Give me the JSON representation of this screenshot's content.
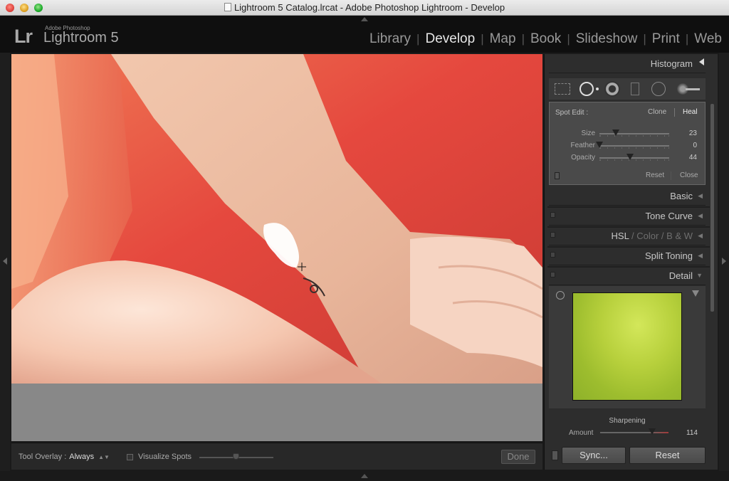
{
  "window": {
    "title": "Lightroom 5 Catalog.lrcat - Adobe Photoshop Lightroom - Develop"
  },
  "header": {
    "logo": "Lr",
    "brand_small": "Adobe Photoshop",
    "brand_name": "Lightroom 5",
    "modules": [
      "Library",
      "Develop",
      "Map",
      "Book",
      "Slideshow",
      "Print",
      "Web"
    ],
    "active_module": "Develop"
  },
  "toolbar": {
    "overlay_label": "Tool Overlay :",
    "overlay_value": "Always",
    "visualize_label": "Visualize Spots",
    "visualize_checked": false,
    "done_label": "Done"
  },
  "panel": {
    "histogram": "Histogram",
    "tools": [
      "grid-crop-icon",
      "spot-removal-icon",
      "red-eye-icon",
      "graduated-filter-icon",
      "radial-filter-icon",
      "adjustment-brush-icon"
    ],
    "spot_edit": {
      "title": "Spot Edit :",
      "clone": "Clone",
      "heal": "Heal",
      "selected_mode": "Heal",
      "sliders": [
        {
          "label": "Size",
          "value": "23",
          "fraction": 0.23
        },
        {
          "label": "Feather",
          "value": "0",
          "fraction": 0.0
        },
        {
          "label": "Opacity",
          "value": "44",
          "fraction": 0.44
        }
      ],
      "reset": "Reset",
      "close": "Close"
    },
    "sections": {
      "basic": "Basic",
      "tone_curve": "Tone Curve",
      "hsl": "HSL",
      "hsl_sep": "/",
      "color": "Color",
      "bw": "B & W",
      "split_toning": "Split Toning",
      "detail": "Detail"
    },
    "sharpening": {
      "title": "Sharpening",
      "amount_label": "Amount",
      "amount_value": "114",
      "fraction": 0.76
    },
    "sync_button": "Sync...",
    "reset_button": "Reset"
  },
  "colors": {
    "accent_text": "#e6e6e6",
    "panel_bg": "#2d2d2d",
    "preview_green": "#b7d03c",
    "photo_red": "#e24a3e"
  }
}
